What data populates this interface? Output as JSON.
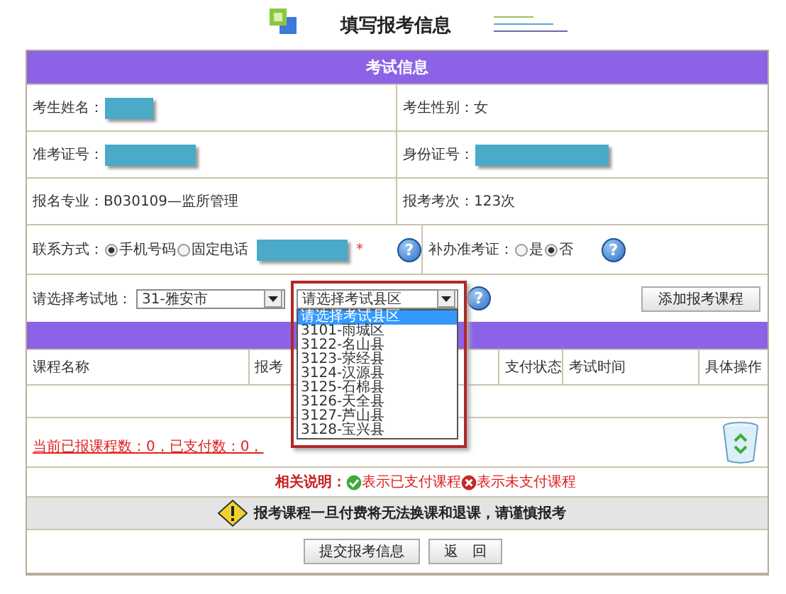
{
  "header": {
    "title": "填写报考信息"
  },
  "section_title": "考试信息",
  "info_rows": [
    [
      {
        "label": "考生姓名：",
        "redacted": true
      },
      {
        "label": "考生性别：",
        "value": "女",
        "redacted": false
      }
    ],
    [
      {
        "label": "准考证号：",
        "redacted": true
      },
      {
        "label": "身份证号：",
        "redacted": true
      }
    ],
    [
      {
        "label": "报名专业：",
        "value": "B030109—监所管理",
        "redacted": false
      },
      {
        "label": "报考考次：",
        "value": "123次",
        "redacted": false
      }
    ]
  ],
  "contact": {
    "label": "联系方式：",
    "options": [
      {
        "label": "手机号码",
        "selected": true
      },
      {
        "label": "固定电话",
        "selected": false
      }
    ],
    "redacted": true,
    "required_mark": "*",
    "help": "?"
  },
  "reissue": {
    "label": "补办准考证：",
    "options": [
      {
        "label": "是",
        "selected": false
      },
      {
        "label": "否",
        "selected": true
      }
    ],
    "help": "?"
  },
  "exam_place": {
    "label": "请选择考试地：",
    "city_select": "31-雅安市",
    "county_select": {
      "value": "请选择考试县区",
      "expanded": true,
      "options": [
        {
          "label": "请选择考试县区",
          "selected": true
        },
        {
          "label": "3101-雨城区",
          "selected": false
        },
        {
          "label": "3122-名山县",
          "selected": false
        },
        {
          "label": "3123-荥经县",
          "selected": false
        },
        {
          "label": "3124-汉源县",
          "selected": false
        },
        {
          "label": "3125-石棉县",
          "selected": false
        },
        {
          "label": "3126-天全县",
          "selected": false
        },
        {
          "label": "3127-芦山县",
          "selected": false
        },
        {
          "label": "3128-宝兴县",
          "selected": false
        }
      ]
    },
    "help": "?",
    "add_button": "添加报考课程"
  },
  "course_table": {
    "columns": [
      "课程名称",
      "报考",
      "支付状态",
      "考试时间",
      "具体操作"
    ]
  },
  "summary": "当前已报课程数：0，已支付数：0，",
  "legend": {
    "label": "相关说明：",
    "paid": "表示已支付课程",
    "unpaid": "表示未支付课程"
  },
  "warning": "报考课程一旦付费将无法换课和退课，请谨慎报考",
  "buttons": [
    "提交报考信息",
    "返　回"
  ]
}
